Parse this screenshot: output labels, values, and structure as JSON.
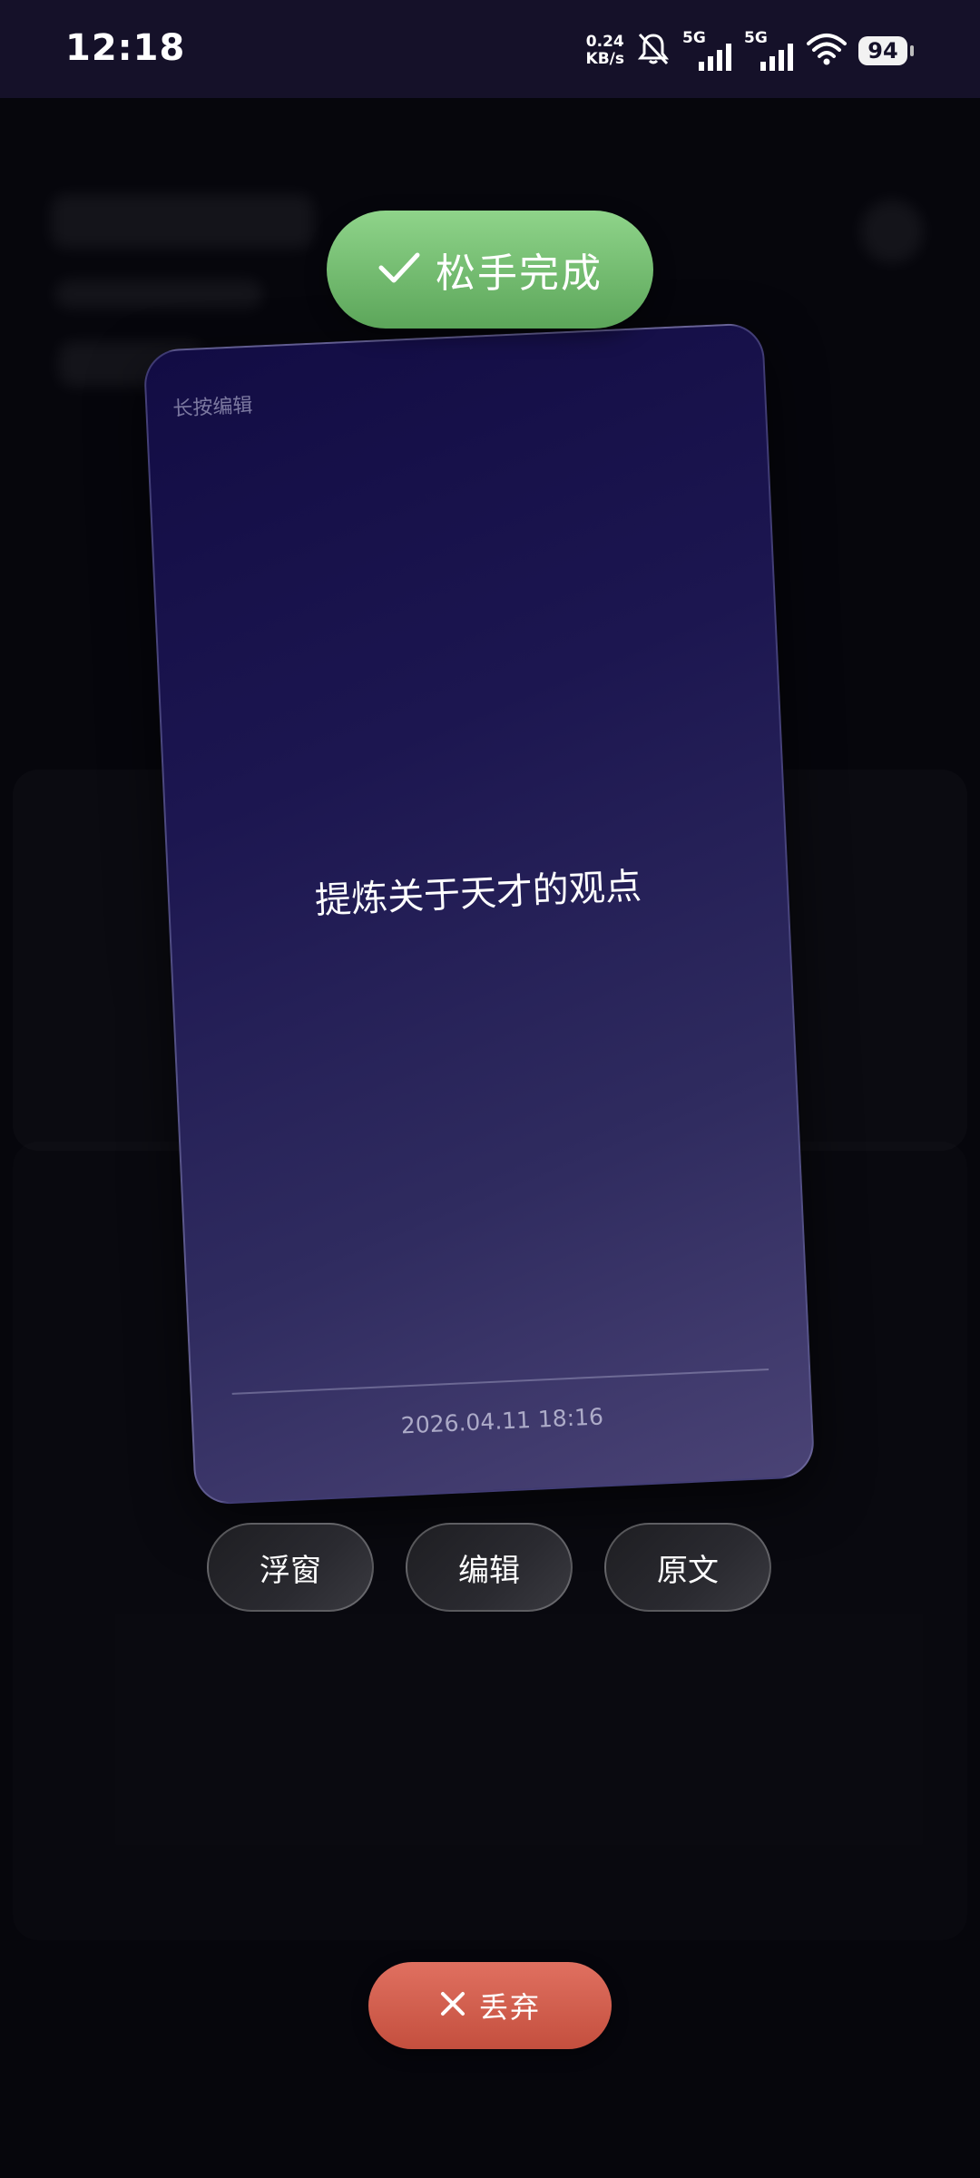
{
  "status_bar": {
    "time": "12:18",
    "net_speed_value": "0.24",
    "net_speed_unit": "KB/s",
    "sim1_label": "5G",
    "sim2_label": "5G",
    "battery": "94"
  },
  "done_pill": {
    "label": "松手完成",
    "icon": "check-icon"
  },
  "card": {
    "hint": "长按编辑",
    "text": "提炼关于天才的观点",
    "date": "2026.04.11 18:16"
  },
  "actions": [
    {
      "label": "浮窗"
    },
    {
      "label": "编辑"
    },
    {
      "label": "原文"
    }
  ],
  "discard": {
    "label": "丢弃",
    "icon": "close-icon"
  },
  "colors": {
    "status_bg": "#151129",
    "done_green": "#6db86a",
    "discard_red": "#d25f4e",
    "card_top": "#120c44",
    "card_bottom": "#4a4375"
  }
}
